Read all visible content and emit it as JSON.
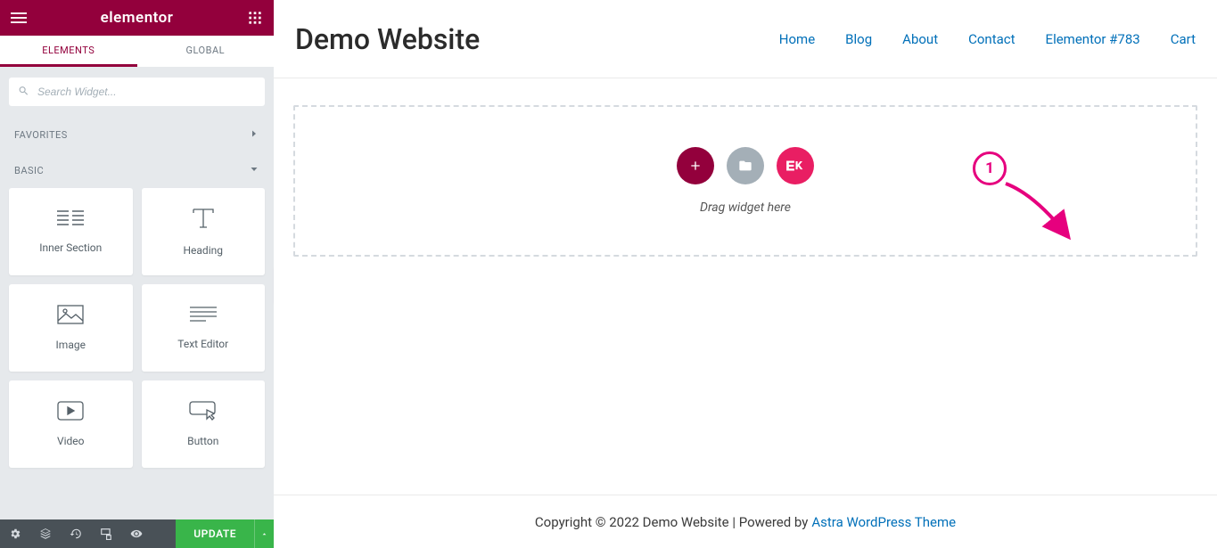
{
  "panel": {
    "brand": "elementor",
    "tabs": {
      "elements": "ELEMENTS",
      "global": "GLOBAL"
    },
    "search_placeholder": "Search Widget...",
    "sections": {
      "favorites": "FAVORITES",
      "basic": "BASIC"
    },
    "widgets": [
      {
        "id": "inner-section",
        "label": "Inner Section"
      },
      {
        "id": "heading",
        "label": "Heading"
      },
      {
        "id": "image",
        "label": "Image"
      },
      {
        "id": "text-editor",
        "label": "Text Editor"
      },
      {
        "id": "video",
        "label": "Video"
      },
      {
        "id": "button",
        "label": "Button"
      }
    ],
    "update_label": "UPDATE"
  },
  "canvas": {
    "site_title": "Demo Website",
    "nav": [
      "Home",
      "Blog",
      "About",
      "Contact",
      "Elementor #783",
      "Cart"
    ],
    "drop_hint": "Drag widget here",
    "footer_text": "Copyright © 2022 Demo Website | Powered by ",
    "footer_link": "Astra WordPress Theme"
  },
  "annotation": {
    "step": "1"
  }
}
